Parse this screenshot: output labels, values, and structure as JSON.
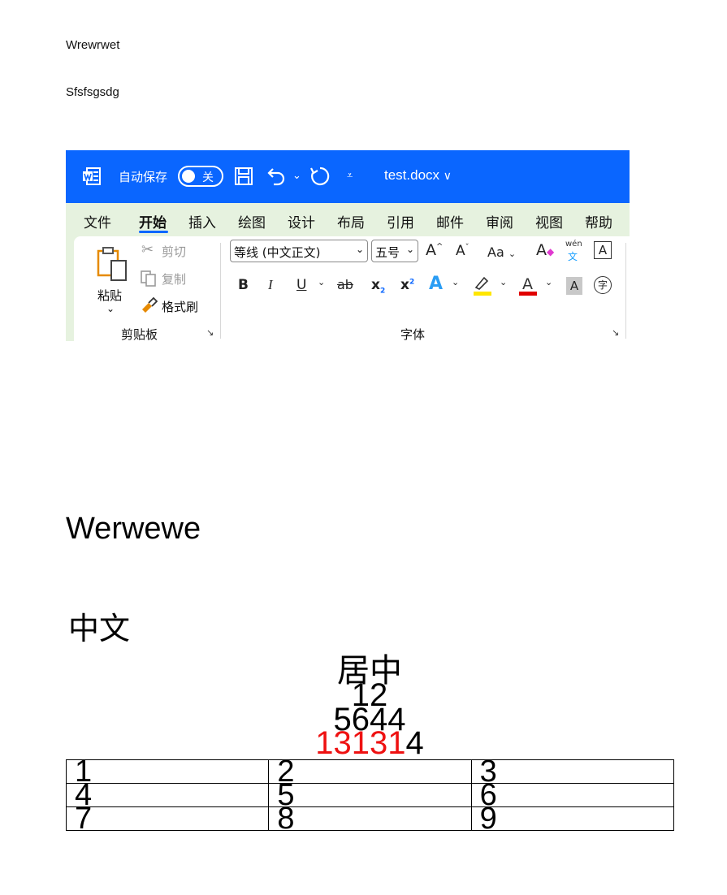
{
  "document": {
    "paragraph_1": "Wrewrwet",
    "paragraph_2": "Sfsfsgsdg",
    "heading_en": "Werwewe",
    "heading_cn": "中文",
    "centered_lines": [
      "居中",
      "12",
      "5644"
    ],
    "mixed_line": {
      "red_part": "13131",
      "black_part": "4"
    },
    "table": [
      [
        "1",
        "2",
        "3"
      ],
      [
        "4",
        "5",
        "6"
      ],
      [
        "7",
        "8",
        "9"
      ]
    ]
  },
  "screenshot": {
    "titlebar": {
      "autosave_label": "自动保存",
      "toggle_state": "关",
      "filename": "test.docx",
      "filename_chevron": "∨",
      "icons": [
        "word-icon",
        "save-icon",
        "undo-icon",
        "redo-icon",
        "customize-icon"
      ],
      "bg_color": "#0a66ff"
    },
    "menu": [
      "文件",
      "开始",
      "插入",
      "绘图",
      "设计",
      "布局",
      "引用",
      "邮件",
      "审阅",
      "视图",
      "帮助"
    ],
    "active_menu": "开始",
    "clipboard": {
      "paste": "粘贴",
      "cut": "剪切",
      "copy": "复制",
      "format_painter": "格式刷",
      "group_label": "剪贴板"
    },
    "font_group": {
      "font_name": "等线 (中文正文)",
      "font_size": "五号",
      "case_button": "Aa",
      "phonetic_top": "wén",
      "phonetic_bottom": "文",
      "bold": "B",
      "italic": "I",
      "underline": "U",
      "strike": "ab",
      "subscript_base": "x",
      "subscript_mark": "2",
      "superscript_base": "x",
      "superscript_mark": "2",
      "group_label": "字体",
      "highlight_color": "#ffe600",
      "font_color": "#e00000"
    }
  }
}
